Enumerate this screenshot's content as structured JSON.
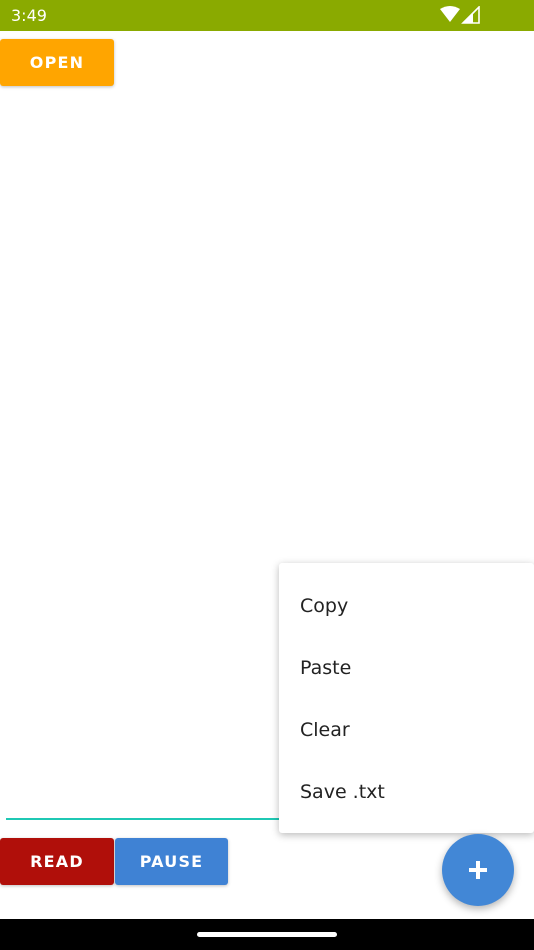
{
  "status_bar": {
    "time": "3:49",
    "background": "#8aaa00",
    "icons": [
      "wifi-icon",
      "signal-icon"
    ]
  },
  "buttons": {
    "open_label": "OPEN",
    "read_label": "READ",
    "pause_label": "PAUSE"
  },
  "popup_menu": {
    "items": [
      {
        "label": "Copy"
      },
      {
        "label": "Paste"
      },
      {
        "label": "Clear"
      },
      {
        "label": "Save .txt"
      }
    ]
  },
  "fab": {
    "icon": "plus-icon"
  },
  "colors": {
    "open": "#ffa500",
    "read": "#b00f0a",
    "pause": "#3f82d4",
    "fab": "#4287d6",
    "underline": "#1fc8b4"
  }
}
